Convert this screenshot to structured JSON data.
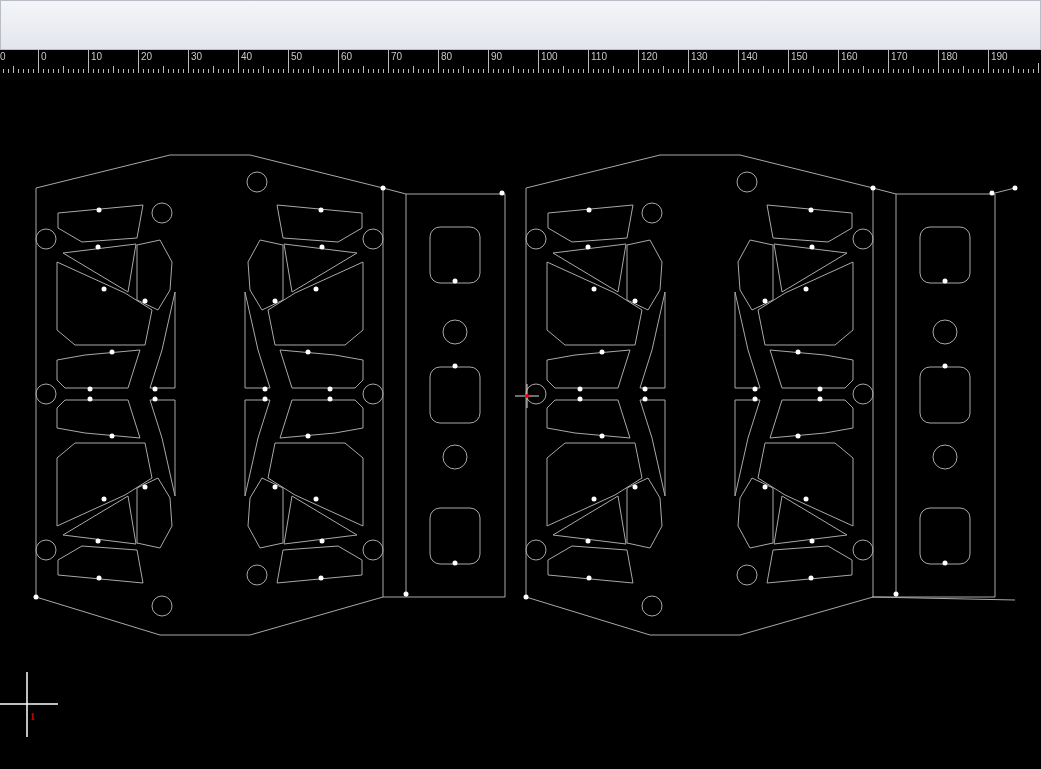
{
  "ruler": {
    "labels": [
      "0",
      "0",
      "10",
      "20",
      "30",
      "40",
      "50",
      "60",
      "70",
      "80",
      "90",
      "100",
      "110",
      "120",
      "130",
      "140",
      "150",
      "160",
      "170",
      "180",
      "190"
    ]
  },
  "origin_marker": {
    "label": "1"
  }
}
